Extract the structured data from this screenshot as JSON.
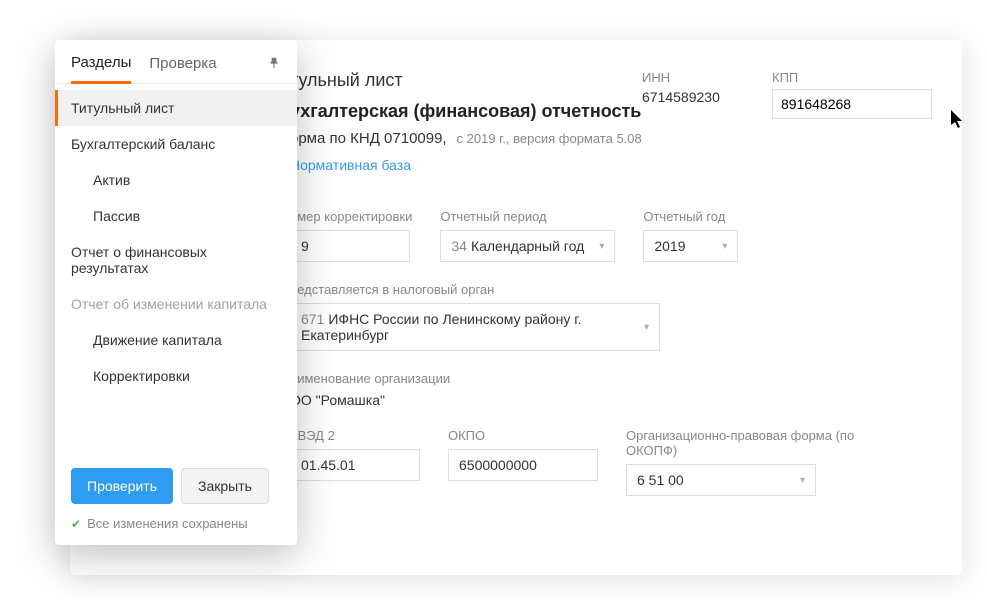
{
  "sidebar": {
    "tabs": {
      "sections": "Разделы",
      "check": "Проверка"
    },
    "items": [
      {
        "label": "Титульный лист"
      },
      {
        "label": "Бухгалтерский баланс"
      },
      {
        "label": "Актив"
      },
      {
        "label": "Пассив"
      },
      {
        "label": "Отчет о финансовых результатах"
      },
      {
        "label": "Отчет об изменении капитала"
      },
      {
        "label": "Движение капитала"
      },
      {
        "label": "Корректировки"
      }
    ],
    "buttons": {
      "check": "Проверить",
      "close": "Закрыть"
    },
    "save_status": "Все изменения сохранены"
  },
  "header": {
    "page_title_suffix": "тульный лист",
    "report_title_suffix": "ухгалтерская (финансовая) отчетность",
    "form_code_suffix": "орма по КНД 0710099,",
    "form_version": "с 2019 г., версия формата 5.08",
    "normative_link": "Нормативная база",
    "inn_label": "ИНН",
    "inn_value": "6714589230",
    "kpp_label": "КПП",
    "kpp_value": "891648268"
  },
  "form": {
    "correction": {
      "label_suffix": "омер корректировки",
      "value_suffix": "9"
    },
    "period": {
      "label": "Отчетный период",
      "code": "34",
      "text": "Календарный год"
    },
    "year": {
      "label": "Отчетный год",
      "value": "2019"
    },
    "tax_auth": {
      "label_suffix": "редставляется в налоговый орган",
      "code_suffix": "671",
      "text": "ИФНС России по Ленинскому району г. Екатеринбург"
    },
    "org": {
      "label_suffix": "аименование организации",
      "name_suffix": "ОО \"Ромашка\""
    },
    "okved": {
      "label_suffix": "КВЭД 2",
      "value_suffix": "01.45.01"
    },
    "okpo": {
      "label": "ОКПО",
      "value": "6500000000"
    },
    "okopf": {
      "label": "Организационно-правовая форма (по ОКОПФ)",
      "value": "6 51 00"
    }
  }
}
